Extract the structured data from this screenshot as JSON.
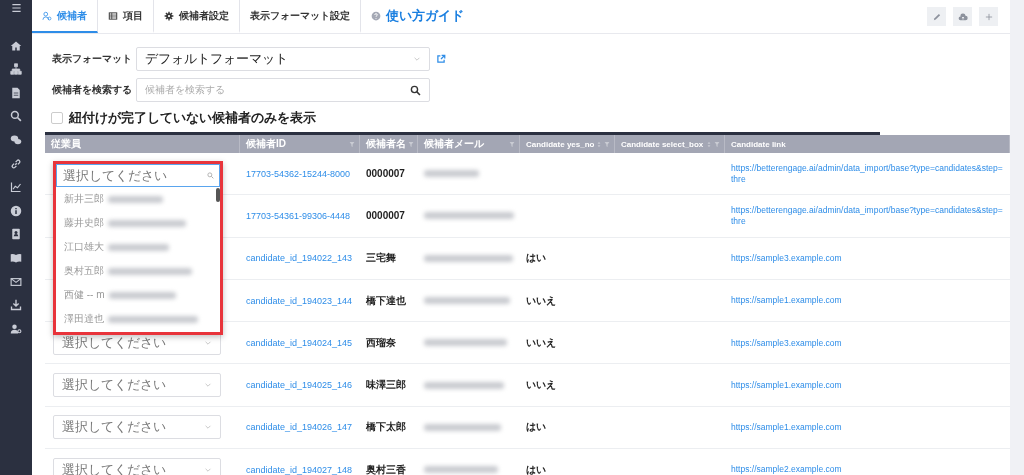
{
  "tabs": [
    {
      "label": "候補者",
      "selected": true
    },
    {
      "label": "項目",
      "selected": false
    },
    {
      "label": "候補者設定",
      "selected": false
    },
    {
      "label": "表示フォーマット設定",
      "selected": false
    },
    {
      "label": "使い方ガイド",
      "selected": false,
      "kind": "link"
    }
  ],
  "form": {
    "format_label": "表示フォーマット",
    "format_value": "デフォルトフォーマット",
    "search_label": "候補者を検索する",
    "search_placeholder": "候補者を検索する",
    "checkbox_label": "紐付けが完了していない候補者のみを表示",
    "checkbox_checked": false
  },
  "table": {
    "columns": [
      {
        "label": "従業員",
        "sortable": false,
        "filter": false
      },
      {
        "label": "候補者ID",
        "sortable": false,
        "filter": true
      },
      {
        "label": "候補者名",
        "sortable": false,
        "filter": true
      },
      {
        "label": "候補者メール",
        "sortable": false,
        "filter": true
      },
      {
        "label": "Candidate yes_no",
        "sortable": true,
        "filter": true
      },
      {
        "label": "Candidate select_box",
        "sortable": true,
        "filter": true
      },
      {
        "label": "Candidate link",
        "sortable": false,
        "filter": false
      }
    ],
    "rows": [
      {
        "employee": "",
        "id": "17703-54362-15244-8000",
        "name": "0000007",
        "yes_no": "",
        "link": "https://betterengage.ai/admin/data_import/base?type=candidates&step=thre"
      },
      {
        "employee": "",
        "id": "17703-54361-99306-4448",
        "name": "0000007",
        "yes_no": "",
        "link": "https://betterengage.ai/admin/data_import/base?type=candidates&step=thre"
      },
      {
        "employee": "",
        "id": "candidate_id_194022_143",
        "name": "三宅舞",
        "yes_no": "はい",
        "link": "https://sample3.example.com"
      },
      {
        "employee": "",
        "id": "candidate_id_194023_144",
        "name": "橋下達也",
        "yes_no": "いいえ",
        "link": "https://sample1.example.com"
      },
      {
        "employee": "選択してください",
        "id": "candidate_id_194024_145",
        "name": "西瑠奈",
        "yes_no": "いいえ",
        "link": "https://sample3.example.com"
      },
      {
        "employee": "選択してください",
        "id": "candidate_id_194025_146",
        "name": "味澤三郎",
        "yes_no": "いいえ",
        "link": "https://sample1.example.com"
      },
      {
        "employee": "選択してください",
        "id": "candidate_id_194026_147",
        "name": "橋下太郎",
        "yes_no": "はい",
        "link": "https://sample1.example.com"
      },
      {
        "employee": "選択してください",
        "id": "candidate_id_194027_148",
        "name": "奥村三香",
        "yes_no": "はい",
        "link": "https://sample2.example.com"
      }
    ]
  },
  "dropdown": {
    "placeholder": "選択してください",
    "options": [
      "新井三郎",
      "藤井史郎",
      "江口雄大",
      "奥村五郎",
      "西健 -- m",
      "澤田達也"
    ]
  }
}
